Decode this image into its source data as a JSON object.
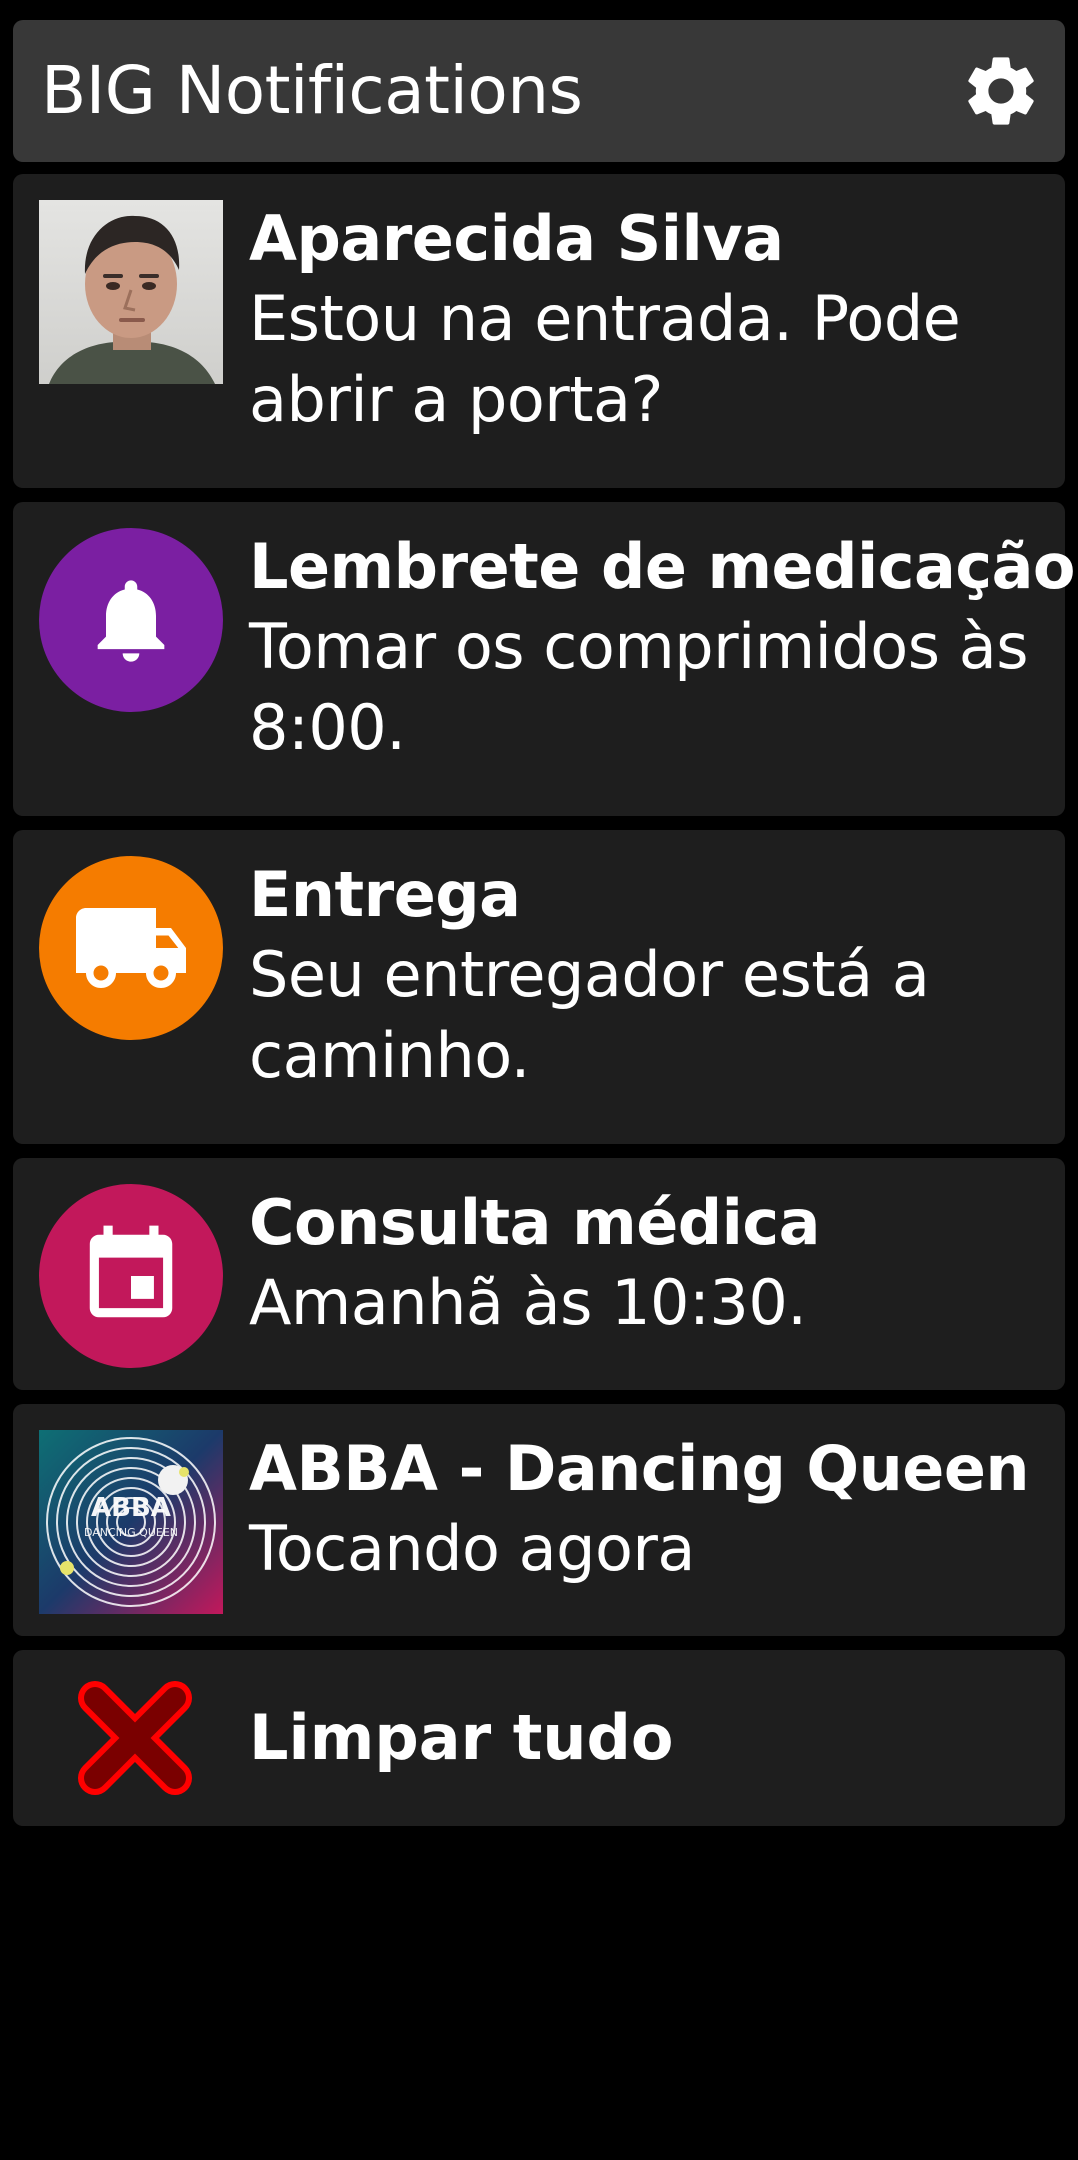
{
  "header": {
    "title": "BIG Notifications",
    "settings_icon": "gear-icon"
  },
  "notifications": [
    {
      "type": "message",
      "title": "Aparecida Silva",
      "body": "Estou na entrada. Pode abrir a porta?",
      "icon": "contact-photo"
    },
    {
      "type": "reminder",
      "title": "Lembrete de medicação",
      "body": "Tomar os comprimidos às 8:00.",
      "icon": "bell-icon",
      "color": "#7b1fa2"
    },
    {
      "type": "delivery",
      "title": "Entrega",
      "body": "Seu entregador está a caminho.",
      "icon": "truck-icon",
      "color": "#f57c00"
    },
    {
      "type": "appointment",
      "title": "Consulta médica",
      "body": "Amanhã às 10:30.",
      "icon": "calendar-icon",
      "color": "#c2185b"
    },
    {
      "type": "media",
      "title": "ABBA - Dancing Queen",
      "body": "Tocando agora",
      "icon": "album-art",
      "album_text": "ABBA",
      "album_subtext": "DANCING QUEEN"
    }
  ],
  "clear_all": {
    "label": "Limpar tudo",
    "icon": "close-x-icon",
    "color": "#d50000"
  },
  "theme": {
    "background": "#000000",
    "card": "#1e1e1e",
    "header": "#383838",
    "text": "#ffffff"
  }
}
